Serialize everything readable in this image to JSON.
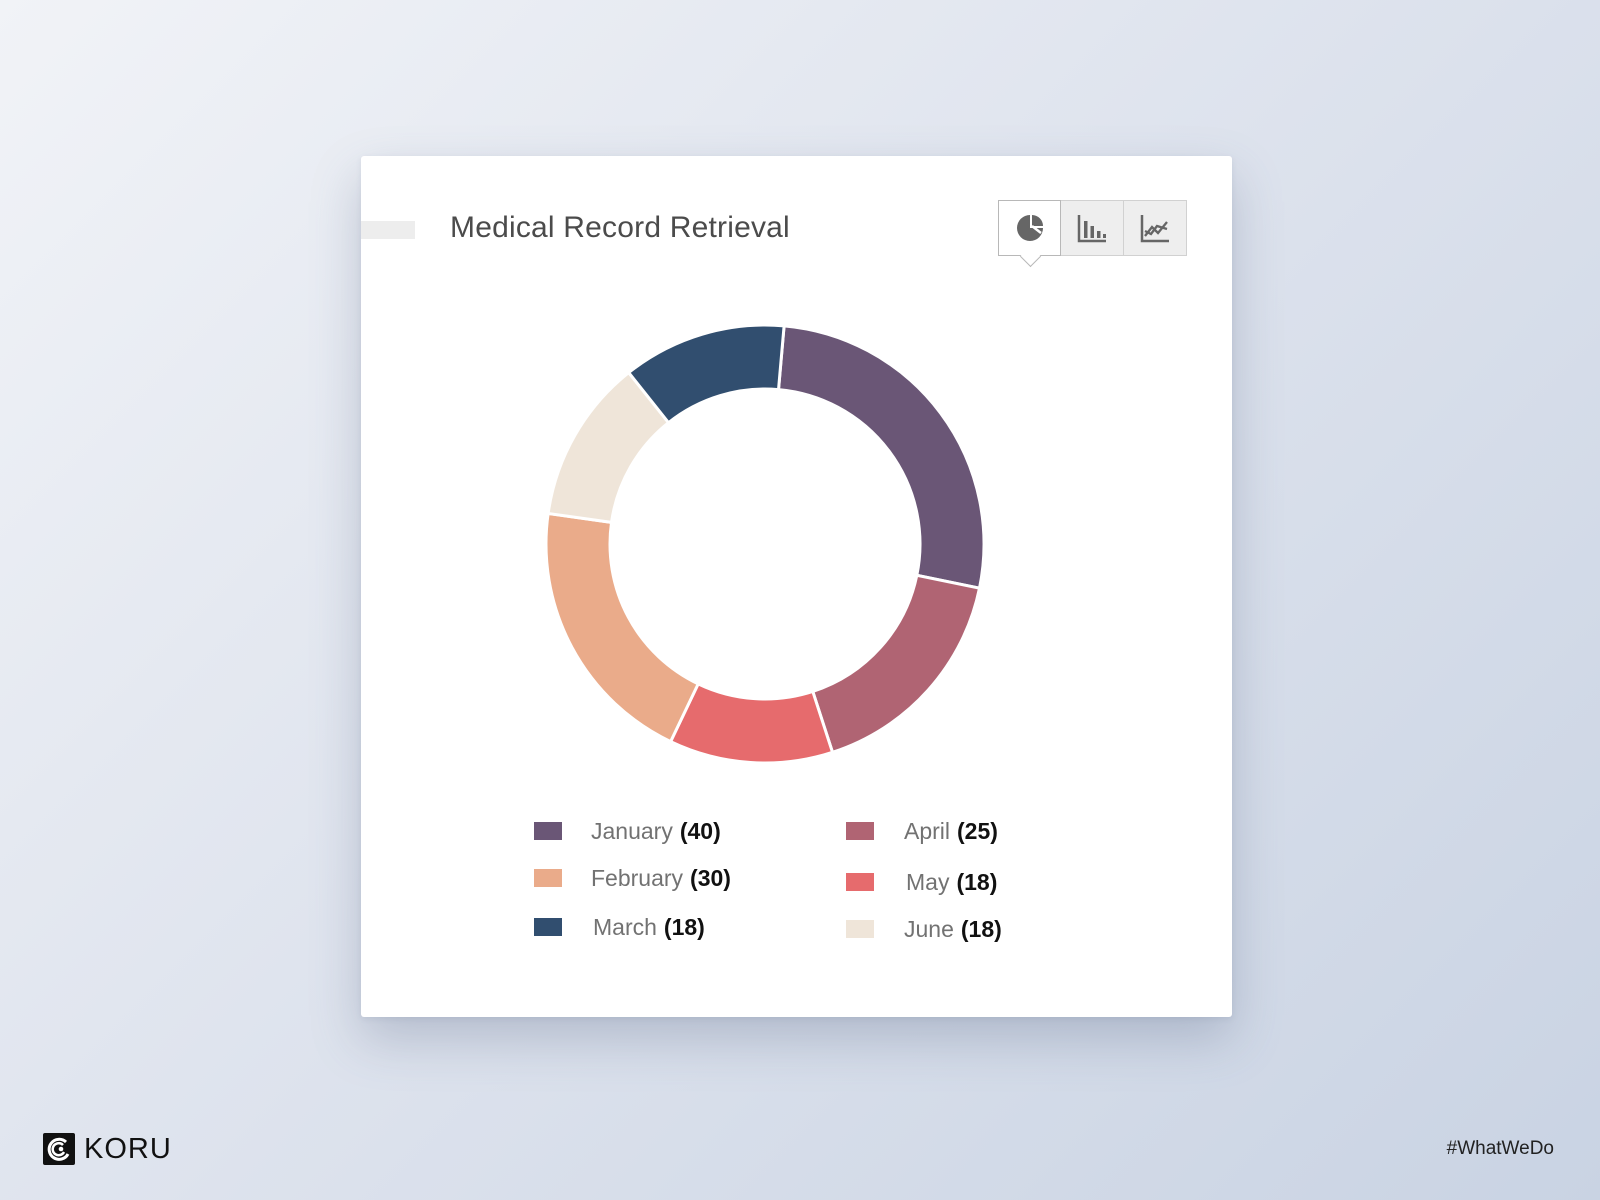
{
  "card": {
    "title": "Medical Record Retrieval"
  },
  "chart_toggle": {
    "active": "pie",
    "buttons": [
      {
        "icon": "pie-chart-icon"
      },
      {
        "icon": "bar-chart-icon"
      },
      {
        "icon": "line-chart-icon"
      }
    ]
  },
  "chart_data": {
    "type": "pie",
    "title": "Medical Record Retrieval",
    "style": "donut",
    "legend_position": "bottom",
    "categories": [
      "January",
      "April",
      "May",
      "February",
      "June",
      "March"
    ],
    "values": [
      40,
      25,
      18,
      30,
      18,
      18
    ],
    "colors": [
      "#6a5676",
      "#b06473",
      "#e66b6d",
      "#eaab8a",
      "#efe5d9",
      "#314e6f"
    ]
  },
  "legend": {
    "items": [
      {
        "label": "January",
        "value": "(40)",
        "color": "#6a5676"
      },
      {
        "label": "February",
        "value": "(30)",
        "color": "#eaab8a"
      },
      {
        "label": "March",
        "value": "(18)",
        "color": "#314e6f"
      },
      {
        "label": "April",
        "value": "(25)",
        "color": "#b06473"
      },
      {
        "label": "May",
        "value": "(18)",
        "color": "#e66b6d"
      },
      {
        "label": "June",
        "value": "(18)",
        "color": "#efe5d9"
      }
    ]
  },
  "footer": {
    "brand": "KORU",
    "hashtag": "#WhatWeDo"
  }
}
